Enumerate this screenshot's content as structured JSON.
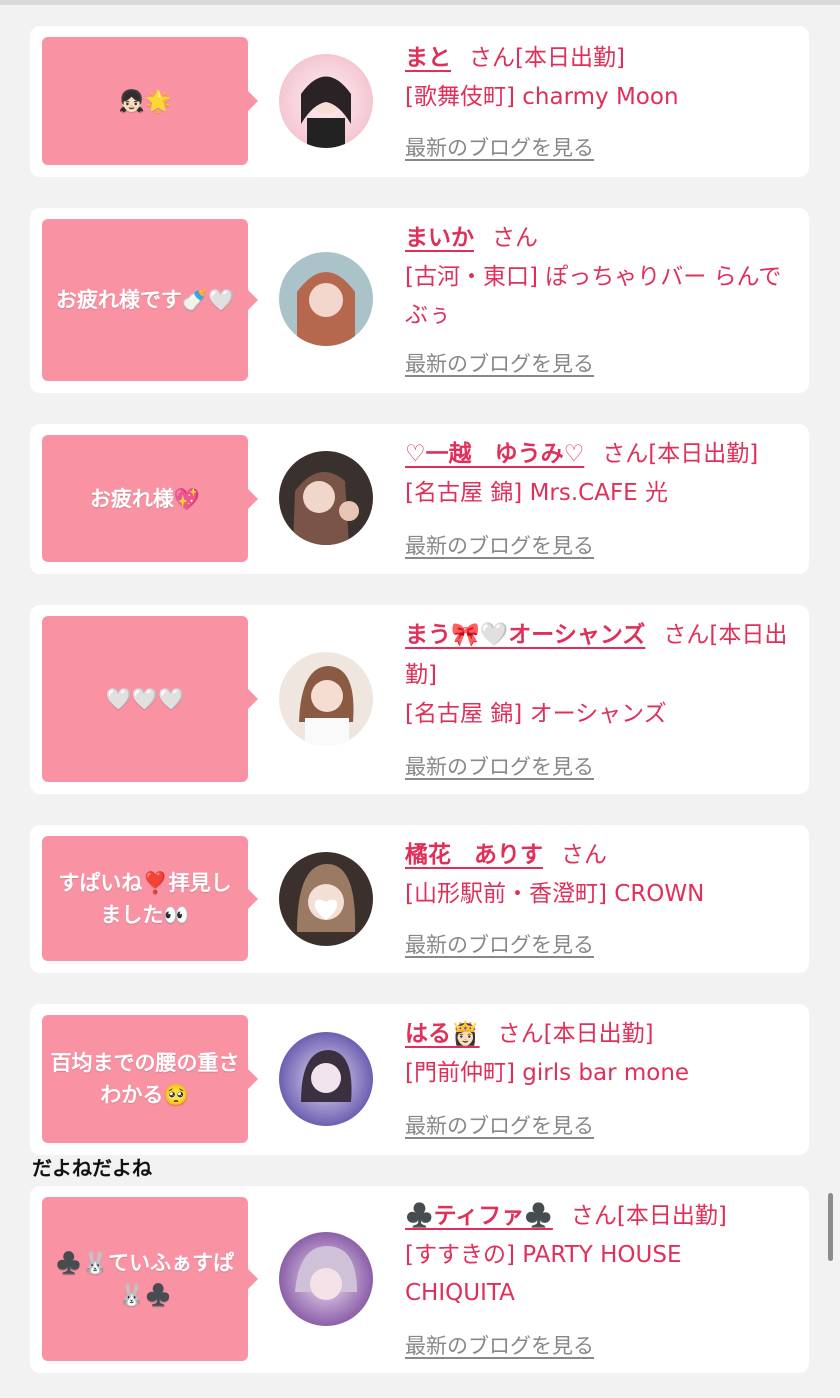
{
  "cards": [
    {
      "bubble": "👧🏻🌟",
      "name": "まと",
      "suffix": "さん[本日出勤]",
      "shop": "[歌舞伎町] charmy Moon",
      "blog": "最新のブログを見る",
      "avatar_color": "#f4c7d2"
    },
    {
      "bubble": "お疲れ様です🍼🤍",
      "name": "まいか",
      "suffix": "さん",
      "shop": "[古河・東口] ぽっちゃりバー らんでぶぅ",
      "blog": "最新のブログを見る",
      "avatar_color": "#c9a08c"
    },
    {
      "bubble": "お疲れ様💖",
      "name": "♡一越　ゆうみ♡",
      "suffix": "さん[本日出勤]",
      "shop": "[名古屋 錦] Mrs.CAFE 光",
      "blog": "最新のブログを見る",
      "avatar_color": "#5b4a45"
    },
    {
      "bubble": "🤍🤍🤍",
      "name": "まう🎀🤍オーシャンズ",
      "suffix": "さん[本日出勤]",
      "shop": "[名古屋 錦] オーシャンズ",
      "blog": "最新のブログを見る",
      "avatar_color": "#e8d4c8"
    },
    {
      "bubble": "すぱいね❣️拝見しました👀",
      "name": "橘花　ありす",
      "suffix": "さん",
      "shop": "[山形駅前・香澄町] CROWN",
      "blog": "最新のブログを見る",
      "avatar_color": "#6e5a52"
    },
    {
      "bubble": "百均までの腰の重さわかる🥺",
      "name": "はる👸🏻",
      "suffix": "さん[本日出勤]",
      "shop": "[門前仲町] girls bar mone",
      "blog": "最新のブログを見る",
      "avatar_color": "#9c88c9"
    },
    {
      "bubble": "♣️🐰ていふぁすぱ🐰♣️",
      "name": "♣️ティファ♣️",
      "suffix": "さん[本日出勤]",
      "shop": "[すすきの] PARTY HOUSE CHIQUITA",
      "blog": "最新のブログを見る",
      "avatar_color": "#c9a6d8"
    }
  ],
  "comment": "だよねだよね",
  "colors": {
    "accent": "#e0305a",
    "bubble": "#f993a4"
  }
}
